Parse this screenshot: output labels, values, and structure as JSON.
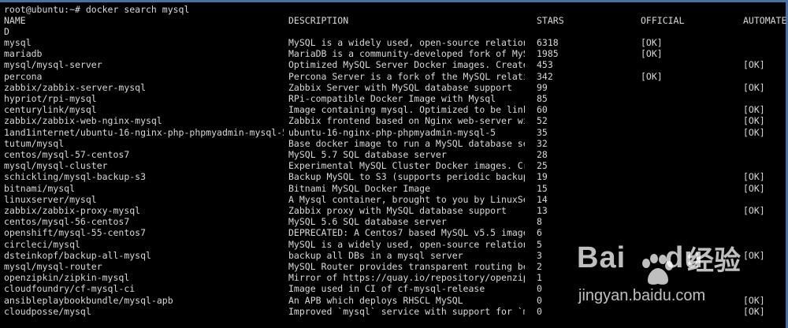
{
  "command_line": "root@ubuntu:~# docker search mysql",
  "header": {
    "name": "NAME",
    "description": "DESCRIPTION",
    "stars": "STARS",
    "official": "OFFICIAL",
    "automated": "AUTOMATE",
    "wrap": "D"
  },
  "rows": [
    {
      "name": "mysql",
      "description": "MySQL is a widely used, open-source relation…",
      "stars": "6318",
      "official": "[OK]",
      "automated": ""
    },
    {
      "name": "mariadb",
      "description": "MariaDB is a community-developed fork of MyS…",
      "stars": "1985",
      "official": "[OK]",
      "automated": ""
    },
    {
      "name": "mysql/mysql-server",
      "description": "Optimized MySQL Server Docker images. Create…",
      "stars": "453",
      "official": "",
      "automated": "[OK]"
    },
    {
      "name": "percona",
      "description": "Percona Server is a fork of the MySQL relati…",
      "stars": "342",
      "official": "[OK]",
      "automated": ""
    },
    {
      "name": "zabbix/zabbix-server-mysql",
      "description": "Zabbix Server with MySQL database support",
      "stars": "99",
      "official": "",
      "automated": "[OK]"
    },
    {
      "name": "hypriot/rpi-mysql",
      "description": "RPi-compatible Docker Image with Mysql",
      "stars": "85",
      "official": "",
      "automated": ""
    },
    {
      "name": "centurylink/mysql",
      "description": "Image containing mysql. Optimized to be link…",
      "stars": "60",
      "official": "",
      "automated": "[OK]"
    },
    {
      "name": "zabbix/zabbix-web-nginx-mysql",
      "description": "Zabbix frontend based on Nginx web-server wi…",
      "stars": "52",
      "official": "",
      "automated": "[OK]"
    },
    {
      "name": "1and1internet/ubuntu-16-nginx-php-phpmyadmin-mysql-5",
      "description": "ubuntu-16-nginx-php-phpmyadmin-mysql-5",
      "stars": "35",
      "official": "",
      "automated": "[OK]"
    },
    {
      "name": "tutum/mysql",
      "description": "Base docker image to run a MySQL database se…",
      "stars": "32",
      "official": "",
      "automated": ""
    },
    {
      "name": "centos/mysql-57-centos7",
      "description": "MySQL 5.7 SQL database server",
      "stars": "28",
      "official": "",
      "automated": ""
    },
    {
      "name": "mysql/mysql-cluster",
      "description": "Experimental MySQL Cluster Docker images. Cr…",
      "stars": "25",
      "official": "",
      "automated": ""
    },
    {
      "name": "schickling/mysql-backup-s3",
      "description": "Backup MySQL to S3 (supports periodic backup…",
      "stars": "19",
      "official": "",
      "automated": "[OK]"
    },
    {
      "name": "bitnami/mysql",
      "description": "Bitnami MySQL Docker Image",
      "stars": "15",
      "official": "",
      "automated": "[OK]"
    },
    {
      "name": "linuxserver/mysql",
      "description": "A Mysql container, brought to you by LinuxSe…",
      "stars": "14",
      "official": "",
      "automated": ""
    },
    {
      "name": "zabbix/zabbix-proxy-mysql",
      "description": "Zabbix proxy with MySQL database support",
      "stars": "13",
      "official": "",
      "automated": "[OK]"
    },
    {
      "name": "centos/mysql-56-centos7",
      "description": "MySQL 5.6 SQL database server",
      "stars": "8",
      "official": "",
      "automated": ""
    },
    {
      "name": "openshift/mysql-55-centos7",
      "description": "DEPRECATED: A Centos7 based MySQL v5.5 image…",
      "stars": "6",
      "official": "",
      "automated": ""
    },
    {
      "name": "circleci/mysql",
      "description": "MySQL is a widely used, open-source relation…",
      "stars": "5",
      "official": "",
      "automated": ""
    },
    {
      "name": "dsteinkopf/backup-all-mysql",
      "description": "backup all DBs in a mysql server",
      "stars": "3",
      "official": "",
      "automated": "[OK]"
    },
    {
      "name": "mysql/mysql-router",
      "description": "MySQL Router provides transparent routing be…",
      "stars": "2",
      "official": "",
      "automated": ""
    },
    {
      "name": "openzipkin/zipkin-mysql",
      "description": "Mirror of https://quay.io/repository/openzip…",
      "stars": "1",
      "official": "",
      "automated": ""
    },
    {
      "name": "cloudfoundry/cf-mysql-ci",
      "description": "Image used in CI of cf-mysql-release",
      "stars": "0",
      "official": "",
      "automated": ""
    },
    {
      "name": "ansibleplaybookbundle/mysql-apb",
      "description": "An APB which deploys RHSCL MySQL",
      "stars": "0",
      "official": "",
      "automated": "[OK]"
    },
    {
      "name": "cloudposse/mysql",
      "description": "Improved `mysql` service with support for `m…",
      "stars": "0",
      "official": "",
      "automated": "[OK]"
    }
  ],
  "watermark": {
    "logo": "Bai",
    "logo_suffix": "du",
    "cn": "经验",
    "url": "jingyan.baidu.com"
  }
}
